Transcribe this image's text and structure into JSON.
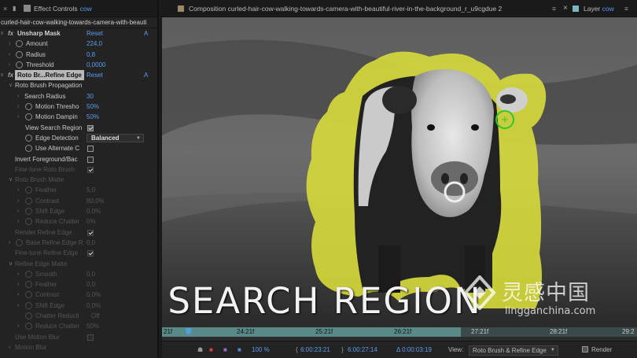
{
  "left_panel": {
    "tab_title": "Effect Controls",
    "tab_layer": "cow",
    "comp_path": "curled-hair-cow-walking-towards-camera-with-beauti",
    "unsharp": {
      "title": "Unsharp Mask",
      "reset": "Reset",
      "about": "A",
      "amount": {
        "label": "Amount",
        "value": "224,0"
      },
      "radius": {
        "label": "Radius",
        "value": "0,8"
      },
      "threshold": {
        "label": "Threshold",
        "value": "0,0000"
      }
    },
    "roto": {
      "title": "Roto Br...Refine Edge",
      "reset": "Reset",
      "about": "A",
      "propagation": "Roto Brush Propagation",
      "search_radius": {
        "label": "Search Radius",
        "value": "30"
      },
      "motion_threshold": {
        "label": "Motion Thresho",
        "value": "50%"
      },
      "motion_damping": {
        "label": "Motion Dampin",
        "value": "50%"
      },
      "view_search_region": "View Search Region",
      "edge_detection": {
        "label": "Edge Detection",
        "value": "Balanced"
      },
      "use_alternate": "Use Alternate C",
      "invert": "Invert Foreground/Bac",
      "fine_tune": "Fine-tune Roto Brush",
      "matte": "Roto Brush Matte",
      "feather": {
        "label": "Feather",
        "value": "5,0"
      },
      "contrast": {
        "label": "Contrast",
        "value": "80,0%"
      },
      "shift_edge": {
        "label": "Shift Edge",
        "value": "0,0%"
      },
      "reduce_chatter": {
        "label": "Reduce Chatter",
        "value": "0%"
      },
      "render_refine": "Render Refine Edge",
      "base_refine": {
        "label": "Base Refine Edge R",
        "value": "0,0"
      },
      "fine_tune_refine": "Fine-tune Refine Edge",
      "refine_matte": "Refine Edge Matte",
      "smooth": {
        "label": "Smooth",
        "value": "0,0"
      },
      "feather2": {
        "label": "Feather",
        "value": "0,0"
      },
      "contrast2": {
        "label": "Contrast",
        "value": "0,0%"
      },
      "shift_edge2": {
        "label": "Shift Edge",
        "value": "0,0%"
      },
      "chatter_reduction": {
        "label": "Chatter Reducti",
        "value": "Off"
      },
      "reduce_chatter2": {
        "label": "Reduce Chatter",
        "value": "50%"
      },
      "motion_blur_use": "Use Motion Blur",
      "motion_blur": "Motion Blur"
    }
  },
  "right_panel": {
    "comp_tab": "Composition curled-hair-cow-walking-towards-camera-with-beautiful-river-in-the-background_r_u9cgdue 2",
    "layer_tab_prefix": "Layer",
    "layer_tab_name": "cow",
    "overlay_caption": "SEARCH REGION",
    "watermark_cn": "灵感中国",
    "watermark_url": "lingganchina.com",
    "timeline_labels": [
      "21f",
      "24:21f",
      "25:21f",
      "26:21f",
      "27:21f",
      "28:21f",
      "29:2"
    ],
    "bottom": {
      "zoom": "100 %",
      "time_start": "6:00:23:21",
      "time_end": "6:00:27:14",
      "duration": "Δ 0:00:03:19",
      "view_label": "View:",
      "view_value": "Roto Brush & Refine Edge",
      "render_label": "Render"
    }
  },
  "colors": {
    "accent_blue": "#5a9cf0",
    "search_region": "#d8dc3a",
    "cursor_green": "#2ec82e"
  }
}
